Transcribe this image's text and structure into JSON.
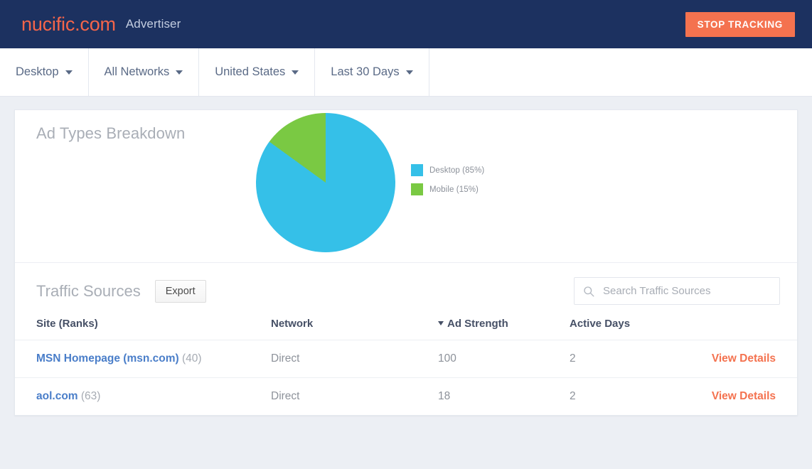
{
  "header": {
    "brand": "nucific.com",
    "role": "Advertiser",
    "stop_tracking_label": "STOP TRACKING",
    "bg_color": "#1c3160",
    "brand_color": "#f4654a",
    "button_color": "#f4724f"
  },
  "filters": [
    {
      "label": "Desktop",
      "name": "device"
    },
    {
      "label": "All Networks",
      "name": "network"
    },
    {
      "label": "United States",
      "name": "country"
    },
    {
      "label": "Last 30 Days",
      "name": "daterange"
    }
  ],
  "chart_card": {
    "title": "Ad Types Breakdown"
  },
  "chart_data": {
    "type": "pie",
    "title": "Ad Types Breakdown",
    "categories": [
      "Desktop",
      "Mobile"
    ],
    "values": [
      85,
      15
    ],
    "labels": [
      "Desktop (85%)",
      "Mobile (15%)"
    ],
    "colors": [
      "#35c0e8",
      "#7ac943"
    ],
    "units": "percent",
    "start_angle": 0,
    "direction": "clockwise",
    "legend_position": "right",
    "grid": false
  },
  "traffic_sources": {
    "title": "Traffic Sources",
    "export_label": "Export",
    "search_placeholder": "Search Traffic Sources",
    "search_value": "",
    "columns": [
      {
        "label": "Site (Ranks)",
        "sorted": false
      },
      {
        "label": "Network",
        "sorted": false
      },
      {
        "label": "Ad Strength",
        "sorted": true,
        "sort_dir": "desc"
      },
      {
        "label": "Active Days",
        "sorted": false
      },
      {
        "label": "",
        "sorted": false
      }
    ],
    "rows": [
      {
        "site": "MSN Homepage (msn.com)",
        "rank": "(40)",
        "network": "Direct",
        "ad_strength": "100",
        "active_days": "2",
        "action": "View Details"
      },
      {
        "site": "aol.com",
        "rank": "(63)",
        "network": "Direct",
        "ad_strength": "18",
        "active_days": "2",
        "action": "View Details"
      }
    ]
  }
}
